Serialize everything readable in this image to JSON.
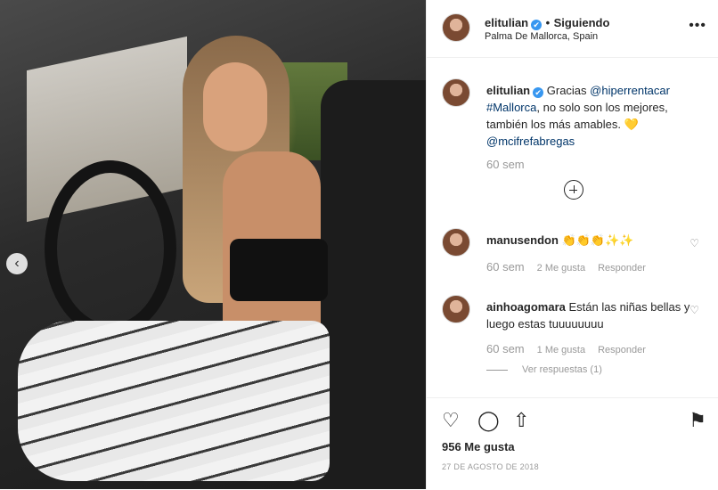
{
  "header": {
    "username": "elitulian",
    "verified_mark": "✔",
    "separator": "•",
    "follow_status": "Siguiendo",
    "location": "Palma De Mallorca, Spain",
    "more_icon": "•••"
  },
  "caption": {
    "username": "elitulian",
    "text_1": "Gracias",
    "mention_1": "@hiperrentacar",
    "hashtag": "#Mallorca",
    "text_2": ", no solo son los mejores, también los más amables.",
    "emoji": "💛",
    "mention_2": "@mcifrefabregas",
    "time": "60 sem"
  },
  "comments": [
    {
      "username": "manusendon",
      "text": "👏👏👏✨✨",
      "time": "60 sem",
      "likes": "2 Me gusta",
      "reply": "Responder"
    },
    {
      "username": "ainhoagomara",
      "text": "Están las niñas bellas y luego estas tuuuuuuuu",
      "time": "60 sem",
      "likes": "1 Me gusta",
      "reply": "Responder",
      "view_replies": "Ver respuestas (1)"
    }
  ],
  "actions": {
    "like_icon": "♡",
    "comment_icon": "◯",
    "share_icon": "⇧",
    "save_icon": "⚑",
    "likes_count": "956 Me gusta",
    "date": "27 DE AGOSTO DE 2018"
  },
  "photo": {
    "prev_icon": "‹"
  }
}
